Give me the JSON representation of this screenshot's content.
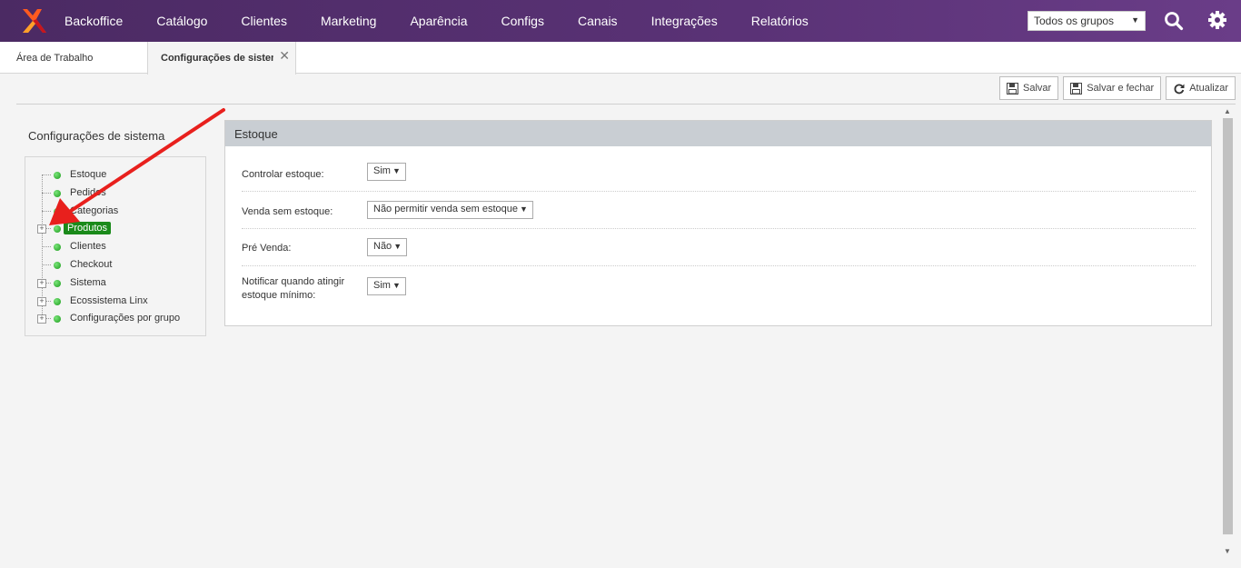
{
  "nav": {
    "items": [
      "Backoffice",
      "Catálogo",
      "Clientes",
      "Marketing",
      "Aparência",
      "Configs",
      "Canais",
      "Integrações",
      "Relatórios"
    ],
    "group_select": "Todos os grupos"
  },
  "tabs": {
    "home": "Área de Trabalho",
    "active": "Configurações de sistema",
    "close_glyph": "✕"
  },
  "toolbar": {
    "save": "Salvar",
    "save_close": "Salvar e fechar",
    "refresh": "Atualizar"
  },
  "sidebar": {
    "title": "Configurações de sistema",
    "items": [
      {
        "label": "Estoque",
        "expandable": false
      },
      {
        "label": "Pedidos",
        "expandable": false
      },
      {
        "label": "Categorias",
        "expandable": false
      },
      {
        "label": "Produtos",
        "expandable": true,
        "selected": true
      },
      {
        "label": "Clientes",
        "expandable": false
      },
      {
        "label": "Checkout",
        "expandable": false
      },
      {
        "label": "Sistema",
        "expandable": true
      },
      {
        "label": "Ecossistema Linx",
        "expandable": true
      },
      {
        "label": "Configurações por grupo",
        "expandable": true
      }
    ]
  },
  "panel": {
    "title": "Estoque",
    "fields": [
      {
        "label": "Controlar estoque:",
        "value": "Sim"
      },
      {
        "label": "Venda sem estoque:",
        "value": "Não permitir venda sem estoque"
      },
      {
        "label": "Pré Venda:",
        "value": "Não"
      },
      {
        "label": "Notificar quando atingir estoque mínimo:",
        "value": "Sim"
      }
    ]
  },
  "colors": {
    "topbar": "#5a3276",
    "selected_tree": "#1a8a1a",
    "annotation_arrow": "#e8201d"
  }
}
